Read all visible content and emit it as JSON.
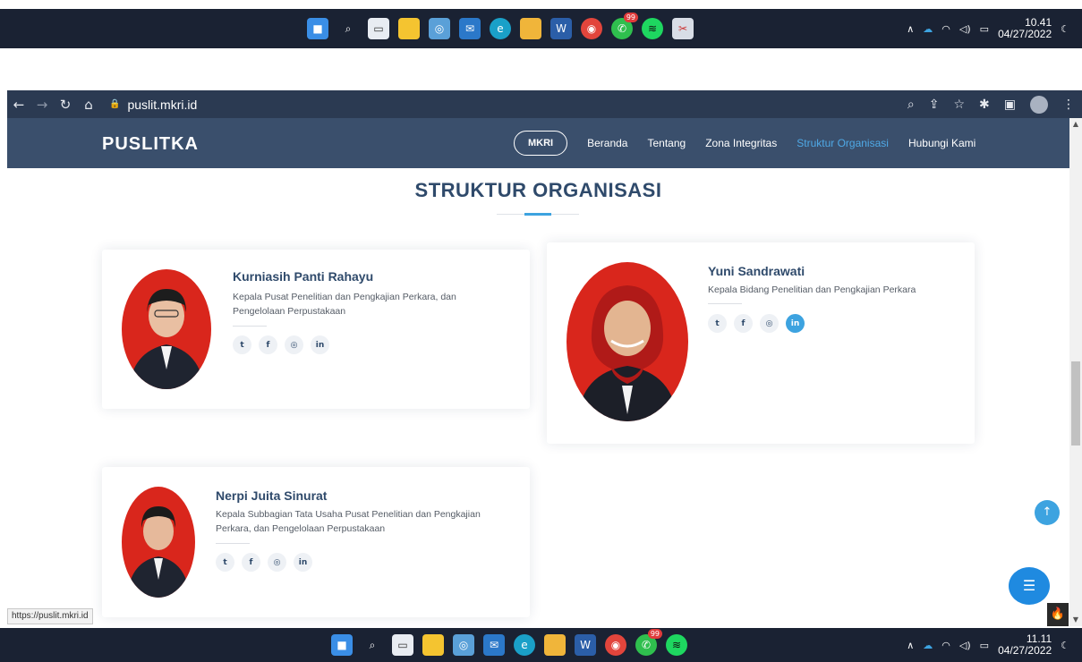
{
  "taskbar_top": {
    "clock_time": "10.41",
    "clock_date": "04/27/2022",
    "whatsapp_badge": "99",
    "icons": [
      "windows-start",
      "search",
      "task-view",
      "sticky-notes",
      "photos",
      "mail",
      "edge",
      "file-explorer",
      "word",
      "chrome",
      "whatsapp",
      "spotify",
      "snipping-tool"
    ]
  },
  "taskbar_bottom": {
    "clock_time": "11.11",
    "clock_date": "04/27/2022",
    "whatsapp_badge": "99"
  },
  "browser": {
    "url": "puslit.mkri.id",
    "status_url": "https://puslit.mkri.id"
  },
  "nav": {
    "logo": "PUSLITKA",
    "mkri_button": "MKRI",
    "links": [
      "Beranda",
      "Tentang",
      "Zona Integritas",
      "Struktur Organisasi",
      "Hubungi Kami"
    ],
    "active_link": "Struktur Organisasi"
  },
  "page": {
    "title": "STRUKTUR ORGANISASI"
  },
  "members": [
    {
      "name": "Kurniasih Panti Rahayu",
      "role": "Kepala Pusat Penelitian dan Pengkajian Perkara, dan Pengelolaan Perpustakaan",
      "socials": [
        "twitter",
        "facebook",
        "instagram",
        "linkedin"
      ]
    },
    {
      "name": "Yuni Sandrawati",
      "role": "Kepala Bidang Penelitian dan Pengkajian Perkara",
      "socials": [
        "twitter",
        "facebook",
        "instagram",
        "linkedin"
      ],
      "active_social": "linkedin"
    },
    {
      "name": "Nerpi Juita Sinurat",
      "role": "Kepala Subbagian Tata Usaha Pusat Penelitian dan Pengkajian Perkara, dan Pengelolaan Perpustakaan",
      "socials": [
        "twitter",
        "facebook",
        "instagram",
        "linkedin"
      ]
    }
  ],
  "colors": {
    "nav_bg": "#3a4f6c",
    "accent": "#3da3e0",
    "title": "#2f4a6b",
    "photo_bg": "#d9261c",
    "taskbar": "#1a2233"
  }
}
